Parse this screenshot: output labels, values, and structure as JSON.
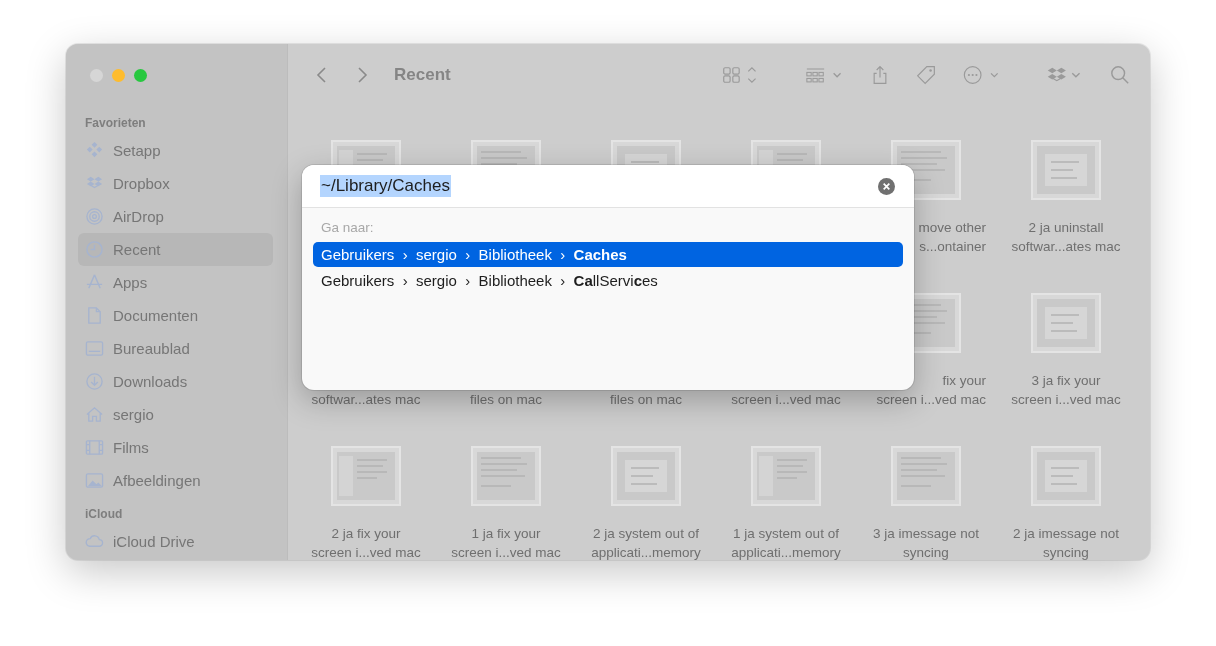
{
  "window": {
    "title": "Recent",
    "controls": [
      {
        "kind": "close",
        "active": false
      },
      {
        "kind": "minimize",
        "active": true
      },
      {
        "kind": "zoom",
        "active": true
      }
    ]
  },
  "sidebar": {
    "sections": [
      {
        "title": "Favorieten",
        "items": [
          {
            "label": "Setapp",
            "selected": false
          },
          {
            "label": "Dropbox",
            "selected": false
          },
          {
            "label": "AirDrop",
            "selected": false
          },
          {
            "label": "Recent",
            "selected": true
          },
          {
            "label": "Apps",
            "selected": false
          },
          {
            "label": "Documenten",
            "selected": false
          },
          {
            "label": "Bureaublad",
            "selected": false
          },
          {
            "label": "Downloads",
            "selected": false
          },
          {
            "label": "sergio",
            "selected": false
          },
          {
            "label": "Films",
            "selected": false
          },
          {
            "label": "Afbeeldingen",
            "selected": false
          }
        ]
      },
      {
        "title": "iCloud",
        "items": [
          {
            "label": "iCloud Drive",
            "selected": false
          }
        ]
      }
    ]
  },
  "files": [
    {
      "kind": "sidebar-window"
    },
    {
      "kind": "text-page"
    },
    {
      "kind": "dialog"
    },
    {
      "kind": "sidebar-window"
    },
    {
      "kind": "text-page",
      "lines": [
        "move other",
        "s...ontainer"
      ],
      "cut": true
    },
    {
      "kind": "dialog",
      "lines": [
        "2 ja uninstall",
        "softwar...ates mac"
      ]
    },
    {
      "lines": [
        "softwar...ates mac"
      ]
    },
    {
      "lines": [
        "files on mac"
      ]
    },
    {
      "lines": [
        "files on mac"
      ]
    },
    {
      "lines": [
        "screen i...ved mac"
      ]
    },
    {
      "kind": "text-page",
      "lines": [
        "fix your",
        "screen i...ved mac"
      ],
      "cut": true
    },
    {
      "kind": "dialog",
      "lines": [
        "3 ja fix your",
        "screen i...ved mac"
      ]
    },
    {
      "kind": "sidebar-window",
      "lines": [
        "2 ja fix your",
        "screen i...ved mac"
      ]
    },
    {
      "kind": "text-page",
      "lines": [
        "1 ja fix your",
        "screen i...ved mac"
      ]
    },
    {
      "kind": "dialog",
      "lines": [
        "2 ja system out of",
        "applicati...memory"
      ]
    },
    {
      "kind": "sidebar-window",
      "lines": [
        "1 ja system out of",
        "applicati...memory"
      ]
    },
    {
      "kind": "text-page",
      "lines": [
        "3 ja imessage not",
        "syncing"
      ]
    },
    {
      "kind": "dialog",
      "lines": [
        "2 ja imessage not",
        "syncing"
      ]
    }
  ],
  "go_to_dialog": {
    "value": "~/Library/Caches",
    "value_selected": true,
    "section_label": "Ga naar:",
    "suggestions": [
      {
        "path": "Gebruikers  ›  sergio  ›  Bibliotheek  ›  **Caches**",
        "selected": true
      },
      {
        "path": "Gebruikers  ›  sergio  ›  Bibliotheek  ›  **Ca**llServi**c**es",
        "selected": false
      }
    ]
  }
}
